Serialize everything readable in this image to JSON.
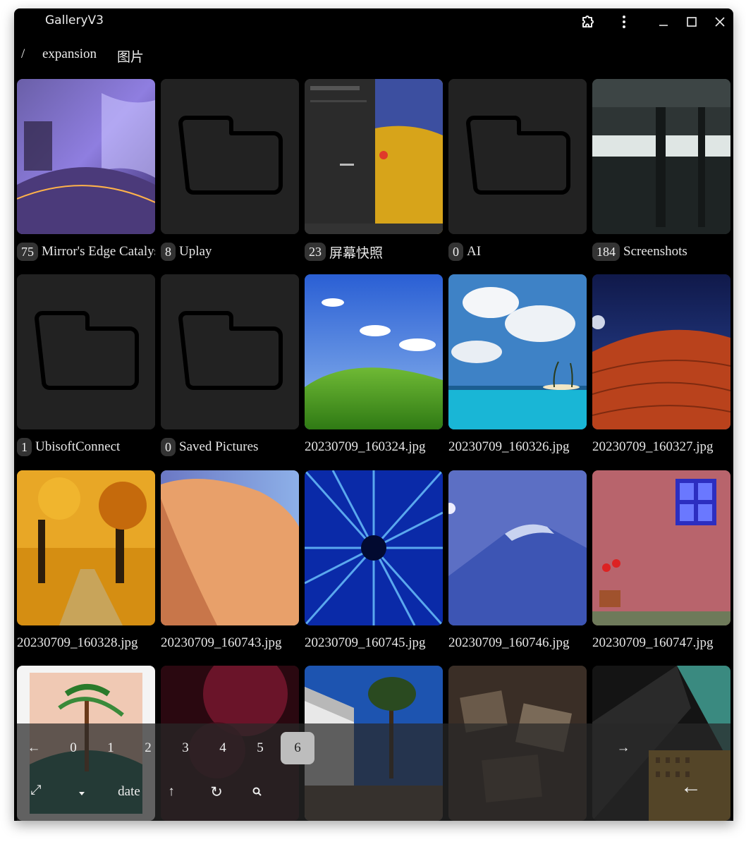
{
  "window": {
    "title": "GalleryV3"
  },
  "titlebar_icons": [
    "extension-icon",
    "more-vertical-icon",
    "minimize-icon",
    "maximize-icon",
    "close-icon"
  ],
  "breadcrumb": {
    "root": "/",
    "items": [
      "expansion",
      "图片"
    ]
  },
  "tiles": [
    {
      "type": "folder",
      "count": "75",
      "name": "Mirror's Edge Catalyst",
      "thumb": "panorama"
    },
    {
      "type": "folder",
      "count": "8",
      "name": "Uplay",
      "thumb": "folder-icon"
    },
    {
      "type": "folder",
      "count": "23",
      "name": "屏幕快照",
      "thumb": "screenshot"
    },
    {
      "type": "folder",
      "count": "0",
      "name": "AI",
      "thumb": "folder-icon"
    },
    {
      "type": "folder",
      "count": "184",
      "name": "Screenshots",
      "thumb": "hall"
    },
    {
      "type": "folder",
      "count": "1",
      "name": "UbisoftConnect",
      "thumb": "folder-icon"
    },
    {
      "type": "folder",
      "count": "0",
      "name": "Saved Pictures",
      "thumb": "folder-icon"
    },
    {
      "type": "image",
      "name": "20230709_160324.jpg",
      "thumb": "bliss"
    },
    {
      "type": "image",
      "name": "20230709_160326.jpg",
      "thumb": "beach"
    },
    {
      "type": "image",
      "name": "20230709_160327.jpg",
      "thumb": "dune-red"
    },
    {
      "type": "image",
      "name": "20230709_160328.jpg",
      "thumb": "autumn"
    },
    {
      "type": "image",
      "name": "20230709_160743.jpg",
      "thumb": "dune-sand"
    },
    {
      "type": "image",
      "name": "20230709_160745.jpg",
      "thumb": "warp"
    },
    {
      "type": "image",
      "name": "20230709_160746.jpg",
      "thumb": "mountain"
    },
    {
      "type": "image",
      "name": "20230709_160747.jpg",
      "thumb": "wall"
    },
    {
      "type": "image",
      "name": "",
      "thumb": "aloha"
    },
    {
      "type": "image",
      "name": "",
      "thumb": "dark-red"
    },
    {
      "type": "image",
      "name": "",
      "thumb": "tree"
    },
    {
      "type": "image",
      "name": "",
      "thumb": "papers"
    },
    {
      "type": "image",
      "name": "",
      "thumb": "building"
    }
  ],
  "pagination": {
    "prev": "←",
    "next": "→",
    "pages": [
      "0",
      "1",
      "2",
      "3",
      "4",
      "5",
      "6"
    ],
    "current": "6"
  },
  "toolbar": {
    "fullscreen": "⤢",
    "sort_dir_icon": "sort-down-icon",
    "sort_label": "date",
    "up": "↑",
    "refresh": "↻",
    "back": "←"
  },
  "colors": {
    "background": "#000000",
    "tile_bg": "#222222",
    "badge_bg": "#333333",
    "active_page_bg": "#bdbdbd"
  }
}
